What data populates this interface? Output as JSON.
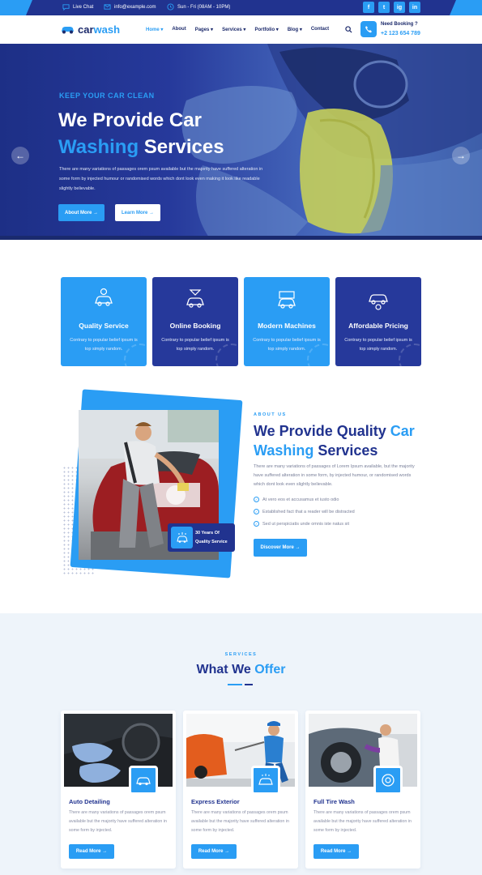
{
  "colors": {
    "primary": "#2a9df4",
    "navy": "#21338f",
    "navy_dark": "#1c2a6b"
  },
  "topbar": {
    "live_chat": "Live Chat",
    "email": "info@example.com",
    "hours": "Sun - Fri (08AM - 10PM)",
    "social": [
      "f",
      "t",
      "ig",
      "in"
    ]
  },
  "header": {
    "logo_part1": "car",
    "logo_part2": "wash",
    "nav": [
      "Home",
      "About",
      "Pages",
      "Services",
      "Portfolio",
      "Blog",
      "Contact"
    ],
    "booking_label": "Need Booking ?",
    "booking_number": "+2 123 654 789"
  },
  "hero": {
    "eyebrow": "KEEP YOUR CAR CLEAN",
    "title_line1": "We Provide Car",
    "title_hl": "Washing",
    "title_rest": "Services",
    "description": "There are many variations of passages orem psum available but the majority have suffered alteration in some form by injected humour or randomised words which dont look even making it look like readable slightly believable.",
    "btn_primary": "About More",
    "btn_secondary": "Learn More"
  },
  "features": [
    {
      "title": "Quality Service",
      "desc": "Contrary to popular belief ipsum is top simply random.",
      "icon": "car-quality-icon"
    },
    {
      "title": "Online Booking",
      "desc": "Contrary to popular belief ipsum is top simply random.",
      "icon": "car-booking-icon"
    },
    {
      "title": "Modern Machines",
      "desc": "Contrary to popular belief ipsum is top simply random.",
      "icon": "car-machine-icon"
    },
    {
      "title": "Affordable Pricing",
      "desc": "Contrary to popular belief ipsum is top simply random.",
      "icon": "car-pricing-icon"
    }
  ],
  "about": {
    "eyebrow": "ABOUT US",
    "title_part1": "We Provide Quality",
    "title_hl": "Car",
    "title_part2_hl": "Washing",
    "title_part2_rest": "Services",
    "description": "There are many variations of passages of Lorem Ipsum available, but the majority have suffered alteration in some form, by injected humour, or randomised words which dont look even slightly believable.",
    "checks": [
      "At vero eos et accusamus et iusto odio",
      "Established fact that a reader will be distracted",
      "Sed ut perspiciatis unde omnis iste natus sit"
    ],
    "button": "Discover More",
    "badge_line1": "30 Years Of",
    "badge_line2": "Quality Service"
  },
  "services": {
    "eyebrow": "SERVICES",
    "title_main": "What We",
    "title_hl": "Offer",
    "cards": [
      {
        "title": "Auto Detailing",
        "desc": "There are many variations of passages orem psum available but the majority have suffered alteration in some form by injected.",
        "button": "Read More"
      },
      {
        "title": "Express Exterior",
        "desc": "There are many variations of passages orem psum available but the majority have suffered alteration in some form by injected.",
        "button": "Read More"
      },
      {
        "title": "Full Tire Wash",
        "desc": "There are many variations of passages orem psum available but the majority have suffered alteration in some form by injected.",
        "button": "Read More"
      }
    ]
  }
}
